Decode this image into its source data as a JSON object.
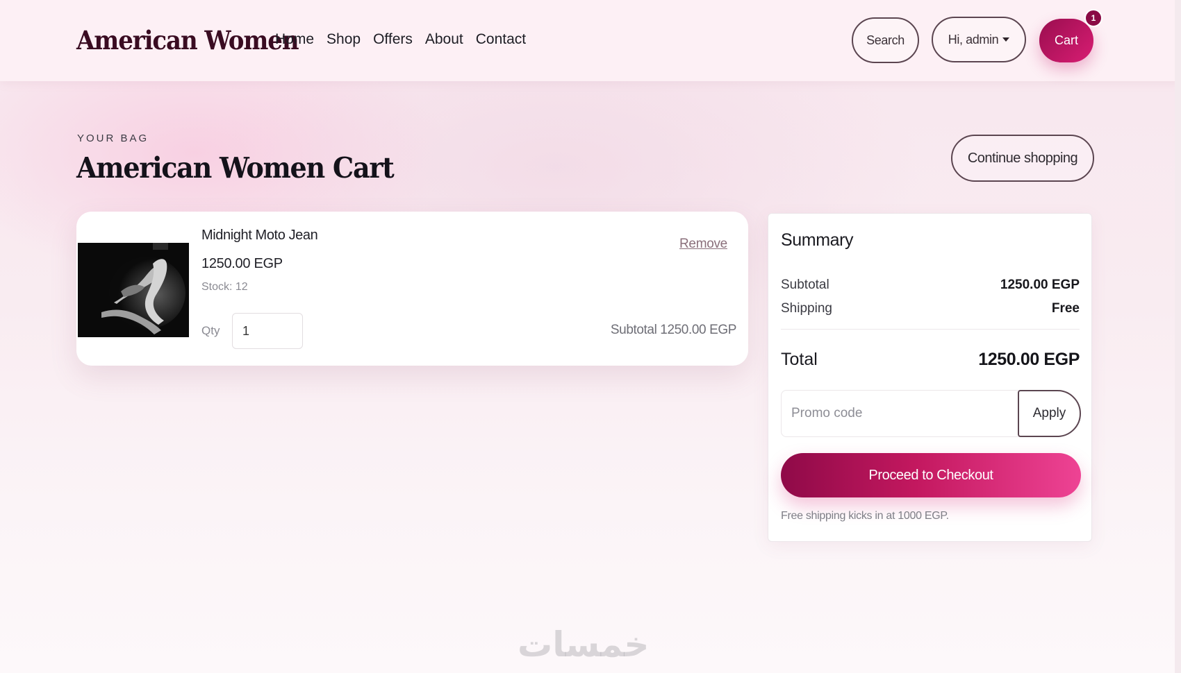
{
  "header": {
    "brand": "American Women",
    "nav": [
      "Home",
      "Shop",
      "Offers",
      "About",
      "Contact"
    ],
    "search_label": "Search",
    "user_label": "Hi, admin",
    "cart_label": "Cart",
    "cart_count": "1"
  },
  "page": {
    "eyebrow": "YOUR BAG",
    "title": "American Women Cart",
    "continue_label": "Continue shopping"
  },
  "cart_items": [
    {
      "name": "Midnight Moto Jean",
      "price": "1250.00 EGP",
      "stock": "Stock: 12",
      "qty_label": "Qty",
      "qty_value": "1",
      "remove_label": "Remove",
      "subtotal": "Subtotal 1250.00 EGP"
    }
  ],
  "summary": {
    "title": "Summary",
    "subtotal_label": "Subtotal",
    "subtotal_value": "1250.00 EGP",
    "shipping_label": "Shipping",
    "shipping_value": "Free",
    "total_label": "Total",
    "total_value": "1250.00 EGP",
    "promo_placeholder": "Promo code",
    "apply_label": "Apply",
    "checkout_label": "Proceed to Checkout",
    "shipping_note": "Free shipping kicks in at 1000 EGP."
  },
  "watermark": "خمسات",
  "colors": {
    "brand": "#3a0c22",
    "accent": "#d81d73",
    "accent_dark": "#8f0a48",
    "page_bg": "#f9ecf1"
  }
}
